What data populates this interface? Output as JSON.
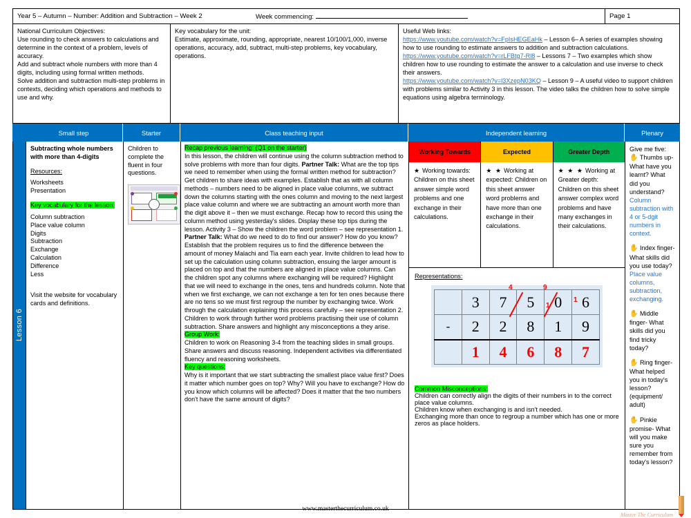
{
  "header": {
    "title": "Year 5 – Autumn – Number: Addition and Subtraction – Week 2",
    "week_commencing_label": "Week commencing:",
    "page_label": "Page 1"
  },
  "info": {
    "objectives_title": "National Curriculum Objectives:",
    "objectives_text": "Use rounding to check answers to calculations and determine in the context of a problem, levels of accuracy.\nAdd and subtract whole numbers with more than 4 digits, including using formal written methods.\nSolve addition and subtraction multi-step problems in contexts, deciding which operations and methods to use and why.",
    "vocab_title": "Key vocabulary for the unit:",
    "vocab_text": "Estimate, approximate, rounding, appropriate, nearest 10/100/1,000, inverse operations, accuracy, add, subtract, multi-step problems, key vocabulary, operations.",
    "links_title": "Useful Web links:",
    "links": [
      {
        "url": "https://www.youtube.com/watch?v=FpIsHEGEaHk",
        "desc": " – Lesson 6– A series of examples showing how to use rounding to estimate answers to addition and subtraction calculations."
      },
      {
        "url": "https://www.youtube.com/watch?v=rLFBtg7-Rl8",
        "desc": " – Lessons 7 – Two examples which show children how to use rounding to estimate the answer to a calculation and use inverse to check their answers."
      },
      {
        "url": "https://www.youtube.com/watch?v=l3XzepN03KQ",
        "desc": " – Lesson 9 – A useful video to support children with problems similar to Activity 3 in this lesson. The video talks the children how to solve simple equations using algebra  terminology."
      }
    ]
  },
  "columns": {
    "small_step": "Small step",
    "starter": "Starter",
    "teaching": "Class teaching input",
    "independent": "Independent learning",
    "plenary": "Plenary"
  },
  "lesson_label": "Lesson 6",
  "small_step": {
    "title": "Subtracting whole numbers with more than 4-digits",
    "resources_label": "Resources:",
    "resources": "Worksheets\nPresentation",
    "vocab_heading": "Key vocabulary for the lesson:",
    "vocab_words": "Column subtraction\nPlace value column\nDigits\nSubtraction\nExchange\nCalculation\nDifference\nLess",
    "website_note": "Visit the website for vocabulary cards and definitions."
  },
  "starter": {
    "text": "Children to complete the fluent in four questions.",
    "thumbnail_name": "fluent-in-four-slide-thumbnail"
  },
  "teaching": {
    "recap_heading": "Recap previous learning: (Q1 on the starter)",
    "para1_a": "In this lesson, the children will continue using the column subtraction method to solve problems with more than four digits. ",
    "partner_talk_1": "Partner Talk:",
    "para1_b": " What are the top tips we need to remember when using the formal written method for subtraction? Get children to share ideas with examples. Establish that as with all column methods – numbers need to be aligned in place value columns, we subtract down the columns starting with the ones column and moving to the next largest place value column and where we are subtracting an amount worth more than the digit above it – then we must exchange. Recap how to record this using the column method using yesterday's slides. Display these top tips during the lesson. Activity 3 – Show the children the  word problem – see representation 1. ",
    "partner_talk_2": "Partner Talk:",
    "para1_c": " What do we need to do to find our answer? How do you know? Establish that the problem requires us to find the difference between the amount of money Malachi and Tia earn each year. Invite children to lead how to set up the calculation using column subtraction, ensuing the larger amount is placed on top and that the numbers are aligned in place value columns. Can the children spot any columns where exchanging will be required? Highlight that we will need to exchange in the ones, tens and hundreds column. Note that when we first exchange, we can not exchange a ten for ten ones because there are no tens so we must first regroup the number by exchanging twice. Work through the calculation explaining this process carefully – see representation 2. Children to work through  further word problems practising their use of column subtraction.  Share answers and highlight any misconceptions a they arise.",
    "group_work_heading": "Group Work:",
    "group_work_text": "Children to work on Reasoning 3-4 from the teaching slides in small groups. Share answers and discuss reasoning. Independent activities via differentiated fluency and reasoning worksheets.",
    "key_questions_heading": "Key questions:",
    "key_questions_text": "Why is it important that we start subtracting the smallest place value first? Does it matter which number goes on top? Why? Will you have to exchange? How do you know which columns will be affected? Does it matter that the two numbers don't have the same amount of digits?"
  },
  "independent": {
    "bands": [
      {
        "label": "Working Towards",
        "color": "#ff0000",
        "stars": "★",
        "text": "Working towards: Children on this sheet answer simple word problems and one exchange in their calculations."
      },
      {
        "label": "Expected",
        "color": "#ffc000",
        "stars": "★ ★",
        "text": "Working at expected: Children on this sheet answer word problems and have more than one exchange in their calculations."
      },
      {
        "label": "Greater Depth",
        "color": "#00b050",
        "stars": "★ ★ ★",
        "text": "Working at Greater depth: Children on this sheet answer complex word problems and have many exchanges in their calculations."
      }
    ],
    "representations_label": "Representations:",
    "misconceptions_heading": "Common Misconceptions:",
    "misconceptions_text": "Children can correctly align the digits of their numbers in to the correct place value columns.\nChildren know when exchanging is and isn't needed.\nExchanging more than once to regroup a number which has one or more zeros as place holders."
  },
  "calculation": {
    "name": "column-subtraction-37506-minus-22819",
    "minuend": [
      "",
      "3",
      "7",
      "5",
      "0",
      "6"
    ],
    "subtrahend": [
      "-",
      "2",
      "2",
      "8",
      "1",
      "9"
    ],
    "answer": [
      "",
      "1",
      "4",
      "6",
      "8",
      "7"
    ],
    "exchange_marks": [
      "4",
      "9",
      "1",
      "1"
    ]
  },
  "plenary": {
    "title": "Give me five:",
    "items": [
      {
        "icon": "hand-icon",
        "prompt": "Thumbs up- What have you learnt? What did you understand?",
        "answer": "Column subtraction with 4 or 5-dgit numbers in context."
      },
      {
        "icon": "hand-icon",
        "prompt": "Index finger- What skills did you use today?",
        "answer": "Place value columns, subtraction, exchanging."
      },
      {
        "icon": "hand-icon",
        "prompt": "Middle finger- What skills did you find tricky today?",
        "answer": ""
      },
      {
        "icon": "hand-icon",
        "prompt": "Ring finger- What helped you in today's lesson? (equipment/ adult)",
        "answer": ""
      },
      {
        "icon": "hand-icon",
        "prompt": "Pinkie promise- What will you make sure you remember from today's lesson?",
        "answer": ""
      }
    ]
  },
  "footer": {
    "website": "www.masterthecurriculum.co.uk",
    "watermark": "Master The Curriculum"
  }
}
